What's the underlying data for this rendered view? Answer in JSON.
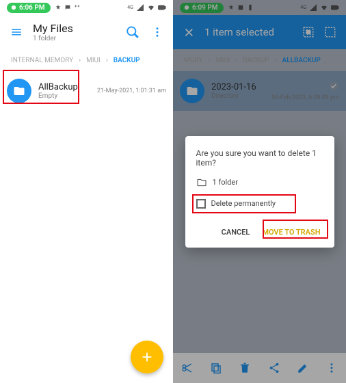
{
  "left": {
    "status": {
      "time": "6:06 PM",
      "signal_label": "4G"
    },
    "header": {
      "title": "My Files",
      "subtitle": "1 folder"
    },
    "breadcrumb": [
      {
        "label": "INTERNAL MEMORY",
        "active": false
      },
      {
        "label": "MIUI",
        "active": false
      },
      {
        "label": "BACKUP",
        "active": true
      }
    ],
    "row": {
      "name": "AllBackup",
      "sub": "Empty",
      "date": "21-May-2021, 1:01:31 am"
    }
  },
  "right": {
    "status": {
      "time": "6:09 PM",
      "signal_label": "4G"
    },
    "header": {
      "title": "1 item selected"
    },
    "breadcrumb": [
      {
        "label": "MORY",
        "active": false
      },
      {
        "label": "MIUI",
        "active": false
      },
      {
        "label": "BACKUP",
        "active": false
      },
      {
        "label": "ALLBACKUP",
        "active": true
      }
    ],
    "row": {
      "name": "2023-01-16",
      "sub": "Directory",
      "date": "06-Feb-2023, 6:09:09 pm"
    },
    "dialog": {
      "title": "Are you sure you want to delete 1 item?",
      "folder_count": "1 folder",
      "permanent": "Delete permanently",
      "cancel": "CANCEL",
      "trash": "MOVE TO TRASH"
    }
  }
}
